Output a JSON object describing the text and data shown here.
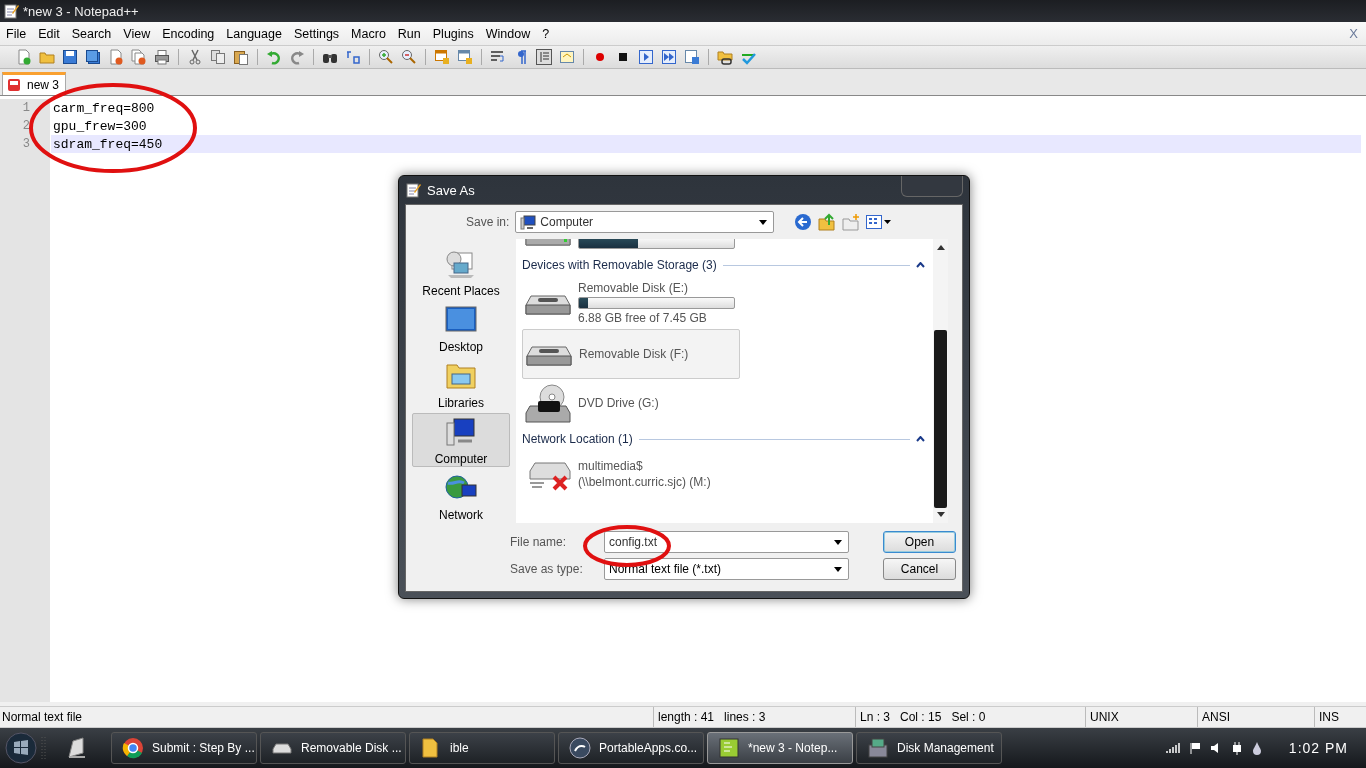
{
  "window": {
    "title": "*new  3 - Notepad++"
  },
  "menu": [
    "File",
    "Edit",
    "Search",
    "View",
    "Encoding",
    "Language",
    "Settings",
    "Macro",
    "Run",
    "Plugins",
    "Window",
    "?"
  ],
  "close_label": "X",
  "tabs": [
    {
      "label": "new  3",
      "selected": true,
      "modified": true
    }
  ],
  "editor": {
    "lines": [
      {
        "number": "1",
        "text": "carm_freq=800",
        "current": false
      },
      {
        "number": "2",
        "text": "gpu_frew=300",
        "current": false
      },
      {
        "number": "3",
        "text": "sdram_freq=450",
        "current": true
      }
    ]
  },
  "status_bar": {
    "file_type": "Normal text file",
    "length": "length : 41",
    "lines": "lines : 3",
    "ln": "Ln : 3",
    "col": "Col : 15",
    "sel": "Sel : 0",
    "eol": "UNIX",
    "encoding": "ANSI",
    "mode": "INS"
  },
  "dialog": {
    "title": "Save As",
    "save_in_label": "Save in:",
    "save_in": "Computer",
    "places": [
      {
        "label": "Recent Places",
        "kind": "recent",
        "selected": false
      },
      {
        "label": "Desktop",
        "kind": "desktop",
        "selected": false
      },
      {
        "label": "Libraries",
        "kind": "libraries",
        "selected": false
      },
      {
        "label": "Computer",
        "kind": "computer",
        "selected": true
      },
      {
        "label": "Network",
        "kind": "network",
        "selected": false
      }
    ],
    "entries": [
      {
        "kind": "partial_drive",
        "level": 0.38
      },
      {
        "kind": "header",
        "label": "Devices with Removable Storage (3)",
        "expanded": true
      },
      {
        "kind": "usb",
        "name": "Removable Disk (E:)",
        "level": 0.06,
        "detail": "6.88 GB free of 7.45 GB",
        "selected": false
      },
      {
        "kind": "usb",
        "name": "Removable Disk (F:)",
        "selected": true
      },
      {
        "kind": "dvd",
        "name": "DVD Drive (G:)",
        "selected": false
      },
      {
        "kind": "header",
        "label": "Network Location (1)",
        "expanded": true
      },
      {
        "kind": "network",
        "name": "multimedia$",
        "detail": "(\\\\belmont.curric.sjc) (M:)",
        "selected": false
      }
    ],
    "file_name_label": "File name:",
    "file_name": "config.txt",
    "type_label": "Save as type:",
    "type": "Normal text file (*.txt)",
    "buttons": [
      {
        "label": "Open",
        "default": true
      },
      {
        "label": "Cancel",
        "default": false
      }
    ]
  },
  "taskbar": {
    "items": [
      {
        "label": "Submit : Step By ...",
        "kind": "browser",
        "active": false
      },
      {
        "label": "Removable Disk ...",
        "kind": "drive",
        "active": false
      },
      {
        "label": "ible",
        "kind": "folder",
        "active": false
      },
      {
        "label": "PortableApps.co...",
        "kind": "portable",
        "active": false
      },
      {
        "label": "*new  3 - Notep...",
        "kind": "notepad",
        "active": true
      },
      {
        "label": "Disk Management",
        "kind": "disk",
        "active": false
      }
    ],
    "clock": "1:02 PM"
  }
}
